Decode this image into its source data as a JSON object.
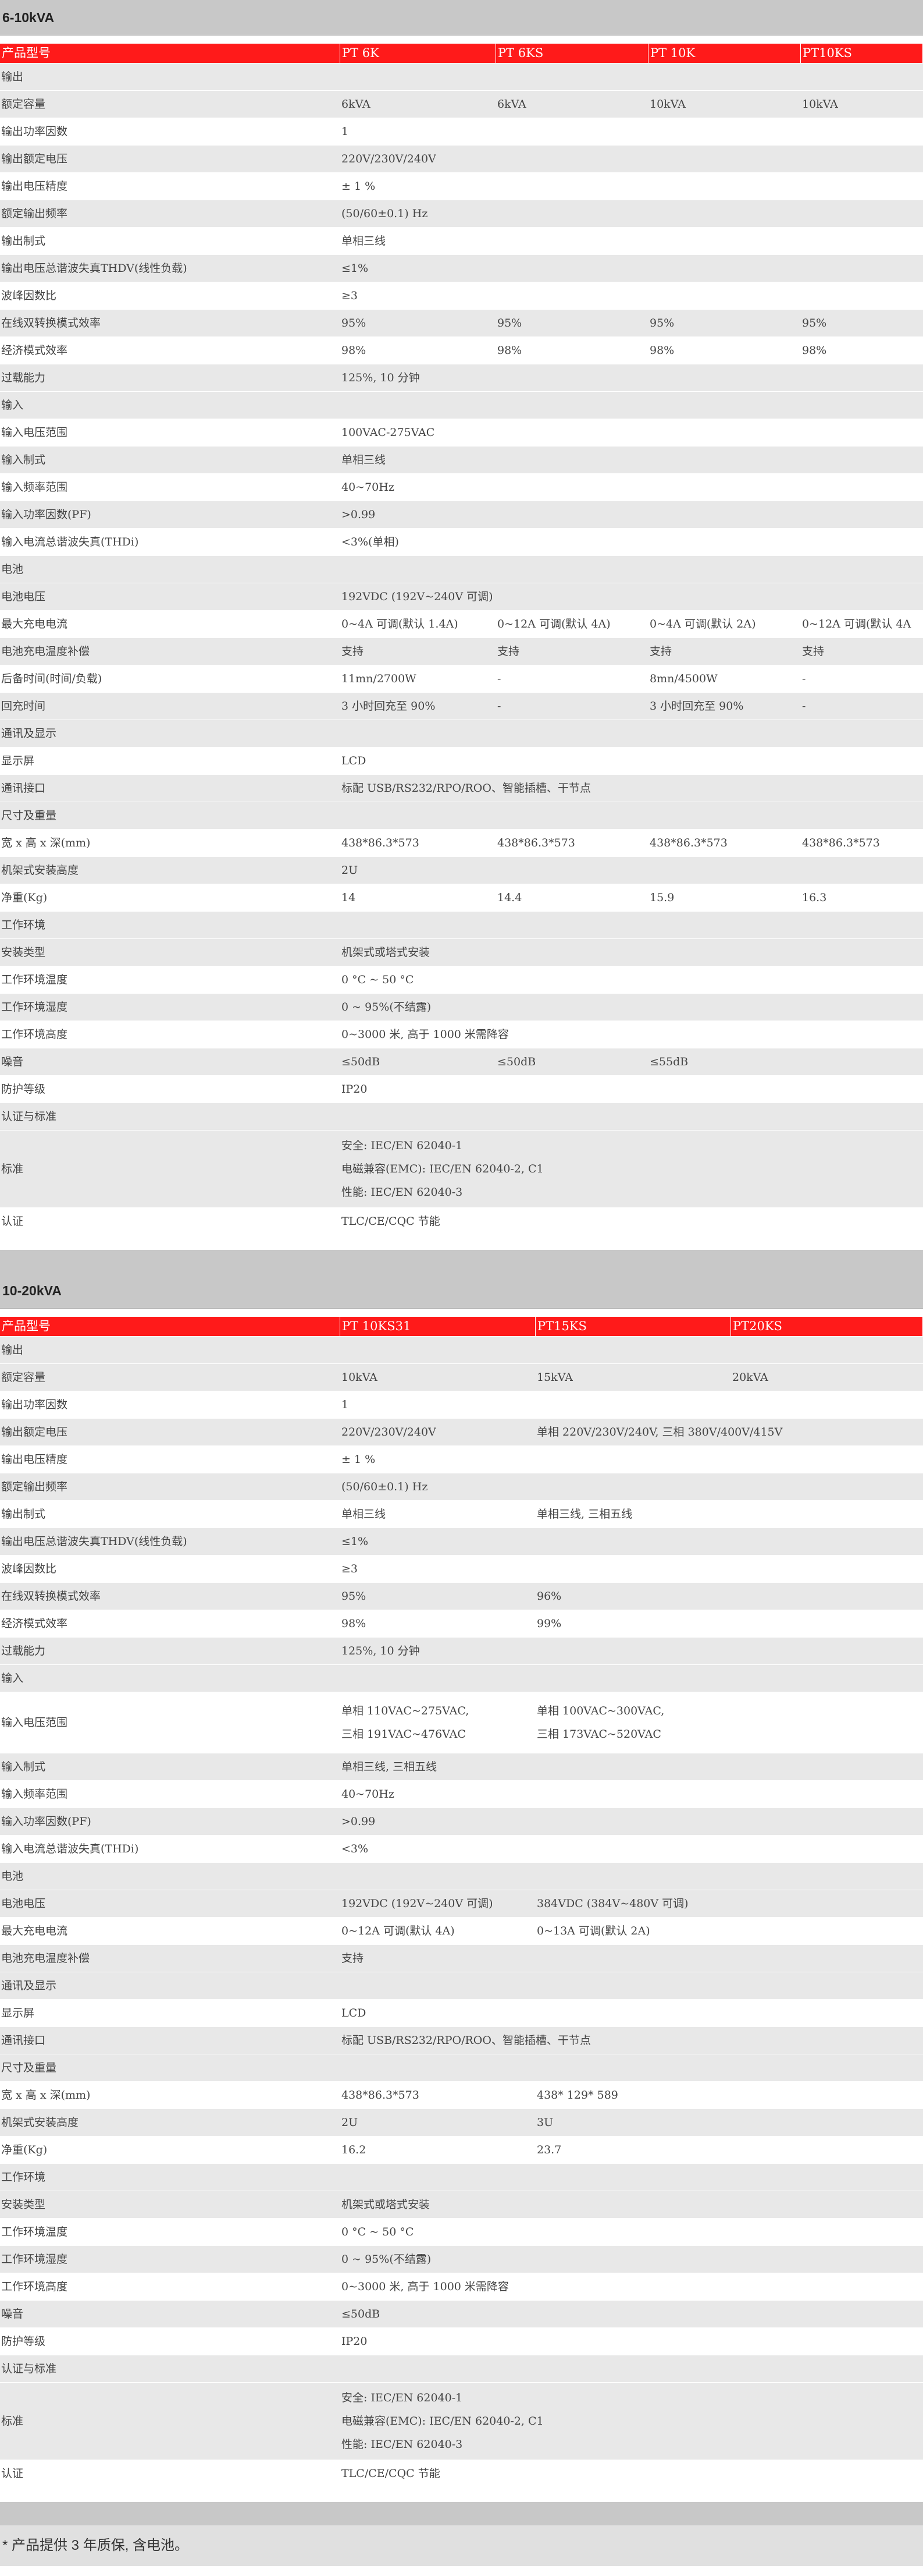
{
  "section1": {
    "title": "6-10kVA",
    "headers": [
      "产品型号",
      "PT 6K",
      "PT 6KS",
      "PT 10K",
      "PT10KS"
    ],
    "rows": [
      {
        "cells": [
          "输出"
        ],
        "cat": true
      },
      {
        "cells": [
          "额定容量",
          "6kVA",
          "6kVA",
          "10kVA",
          "10kVA"
        ]
      },
      {
        "cells": [
          "输出功率因数",
          "1"
        ]
      },
      {
        "cells": [
          "输出额定电压",
          "220V/230V/240V"
        ]
      },
      {
        "cells": [
          "输出电压精度",
          "± 1 %"
        ]
      },
      {
        "cells": [
          "额定输出频率",
          "(50/60±0.1) Hz"
        ]
      },
      {
        "cells": [
          "输出制式",
          "单相三线"
        ]
      },
      {
        "cells": [
          "输出电压总谐波失真THDV(线性负载)",
          "≤1%"
        ]
      },
      {
        "cells": [
          "波峰因数比",
          "≥3"
        ]
      },
      {
        "cells": [
          "在线双转换模式效率",
          "95%",
          "95%",
          "95%",
          "95%"
        ]
      },
      {
        "cells": [
          "经济模式效率",
          "98%",
          "98%",
          "98%",
          "98%"
        ]
      },
      {
        "cells": [
          "过载能力",
          "125%, 10 分钟"
        ]
      },
      {
        "cells": [
          "输入"
        ],
        "cat": true
      },
      {
        "cells": [
          "输入电压范围",
          "100VAC-275VAC"
        ]
      },
      {
        "cells": [
          "输入制式",
          "单相三线"
        ]
      },
      {
        "cells": [
          "输入频率范围",
          "40~70Hz"
        ]
      },
      {
        "cells": [
          "输入功率因数(PF)",
          ">0.99"
        ]
      },
      {
        "cells": [
          "输入电流总谐波失真(THDi)",
          "<3%(单相)"
        ]
      },
      {
        "cells": [
          "电池"
        ],
        "cat": true
      },
      {
        "cells": [
          "电池电压",
          "192VDC (192V~240V 可调)"
        ]
      },
      {
        "cells": [
          "最大充电电流",
          "0~4A 可调(默认 1.4A)",
          "0~12A 可调(默认 4A)",
          "0~4A 可调(默认 2A)",
          "0~12A 可调(默认 4A"
        ]
      },
      {
        "cells": [
          "电池充电温度补偿",
          "支持",
          "支持",
          "支持",
          "支持"
        ]
      },
      {
        "cells": [
          "后备时间(时间/负载)",
          "11mn/2700W",
          "-",
          "8mn/4500W",
          "-"
        ]
      },
      {
        "cells": [
          "回充时间",
          "3 小时回充至 90%",
          "-",
          "3 小时回充至 90%",
          "-"
        ]
      },
      {
        "cells": [
          "通讯及显示"
        ],
        "cat": true
      },
      {
        "cells": [
          "显示屏",
          "LCD"
        ]
      },
      {
        "cells": [
          "通讯接口",
          "标配 USB/RS232/RPO/ROO、智能插槽、干节点"
        ]
      },
      {
        "cells": [
          "尺寸及重量"
        ],
        "cat": true
      },
      {
        "cells": [
          "宽 x 高 x 深(mm)",
          "438*86.3*573",
          "438*86.3*573",
          "438*86.3*573",
          "438*86.3*573"
        ]
      },
      {
        "cells": [
          "机架式安装高度",
          "2U"
        ]
      },
      {
        "cells": [
          "净重(Kg)",
          "14",
          "14.4",
          "15.9",
          "16.3"
        ]
      },
      {
        "cells": [
          "工作环境"
        ],
        "cat": true
      },
      {
        "cells": [
          "安装类型",
          "机架式或塔式安装"
        ]
      },
      {
        "cells": [
          "工作环境温度",
          "0 °C ~ 50 °C"
        ]
      },
      {
        "cells": [
          "工作环境湿度",
          "0 ~ 95%(不结露)"
        ]
      },
      {
        "cells": [
          "工作环境高度",
          "0~3000 米, 高于 1000 米需降容"
        ]
      },
      {
        "cells": [
          "噪音",
          "≤50dB",
          "≤50dB",
          "≤55dB"
        ]
      },
      {
        "cells": [
          "防护等级",
          "IP20"
        ]
      },
      {
        "cells": [
          "认证与标准"
        ],
        "cat": true
      },
      {
        "cells": [
          "标准",
          "安全: IEC/EN 62040-1\n电磁兼容(EMC): IEC/EN 62040-2, C1\n性能: IEC/EN 62040-3"
        ],
        "multi": true
      },
      {
        "cells": [
          "认证",
          "TLC/CE/CQC 节能"
        ]
      }
    ]
  },
  "section2": {
    "title": "10-20kVA",
    "headers": [
      "产品型号",
      "PT 10KS31",
      "PT15KS",
      "PT20KS"
    ],
    "rows": [
      {
        "cells": [
          "输出"
        ],
        "cat": true
      },
      {
        "cells": [
          "额定容量",
          "10kVA",
          "15kVA",
          "20kVA"
        ]
      },
      {
        "cells": [
          "输出功率因数",
          "1"
        ]
      },
      {
        "cells": [
          "输出额定电压",
          "220V/230V/240V",
          "单相 220V/230V/240V, 三相 380V/400V/415V"
        ]
      },
      {
        "cells": [
          "输出电压精度",
          "± 1 %"
        ]
      },
      {
        "cells": [
          "额定输出频率",
          "(50/60±0.1) Hz"
        ]
      },
      {
        "cells": [
          "输出制式",
          "单相三线",
          "单相三线, 三相五线"
        ]
      },
      {
        "cells": [
          "输出电压总谐波失真THDV(线性负载)",
          "≤1%"
        ]
      },
      {
        "cells": [
          "波峰因数比",
          "≥3"
        ]
      },
      {
        "cells": [
          "在线双转换模式效率",
          "95%",
          "96%"
        ]
      },
      {
        "cells": [
          "经济模式效率",
          "98%",
          "99%"
        ]
      },
      {
        "cells": [
          "过载能力",
          "125%, 10 分钟"
        ]
      },
      {
        "cells": [
          "输入"
        ],
        "cat": true
      },
      {
        "cells": [
          "输入电压范围",
          "单相 110VAC~275VAC,\n三相 191VAC~476VAC",
          "单相 100VAC~300VAC,\n三相 173VAC~520VAC"
        ],
        "multi": true
      },
      {
        "cells": [
          "输入制式",
          "单相三线, 三相五线"
        ]
      },
      {
        "cells": [
          "输入频率范围",
          "40~70Hz"
        ]
      },
      {
        "cells": [
          "输入功率因数(PF)",
          ">0.99"
        ]
      },
      {
        "cells": [
          "输入电流总谐波失真(THDi)",
          "<3%"
        ]
      },
      {
        "cells": [
          "电池"
        ],
        "cat": true
      },
      {
        "cells": [
          "电池电压",
          "192VDC (192V~240V 可调)",
          "384VDC (384V~480V 可调)"
        ]
      },
      {
        "cells": [
          "最大充电电流",
          "0~12A 可调(默认 4A)",
          "0~13A 可调(默认 2A)"
        ]
      },
      {
        "cells": [
          "电池充电温度补偿",
          "支持"
        ]
      },
      {
        "cells": [
          "通讯及显示"
        ],
        "cat": true
      },
      {
        "cells": [
          "显示屏",
          "LCD"
        ]
      },
      {
        "cells": [
          "通讯接口",
          "标配 USB/RS232/RPO/ROO、智能插槽、干节点"
        ]
      },
      {
        "cells": [
          "尺寸及重量"
        ],
        "cat": true
      },
      {
        "cells": [
          "宽 x 高 x 深(mm)",
          "438*86.3*573",
          "438* 129* 589"
        ]
      },
      {
        "cells": [
          "机架式安装高度",
          "2U",
          "3U"
        ]
      },
      {
        "cells": [
          "净重(Kg)",
          "16.2",
          "23.7"
        ]
      },
      {
        "cells": [
          "工作环境"
        ],
        "cat": true
      },
      {
        "cells": [
          "安装类型",
          "机架式或塔式安装"
        ]
      },
      {
        "cells": [
          "工作环境温度",
          "0 °C ~ 50 °C"
        ]
      },
      {
        "cells": [
          "工作环境湿度",
          "0 ~ 95%(不结露)"
        ]
      },
      {
        "cells": [
          "工作环境高度",
          "0~3000 米, 高于 1000 米需降容"
        ]
      },
      {
        "cells": [
          "噪音",
          "≤50dB"
        ]
      },
      {
        "cells": [
          "防护等级",
          "IP20"
        ]
      },
      {
        "cells": [
          "认证与标准"
        ],
        "cat": true
      },
      {
        "cells": [
          "标准",
          "安全: IEC/EN 62040-1\n电磁兼容(EMC): IEC/EN 62040-2, C1\n性能: IEC/EN 62040-3"
        ],
        "multi": true
      },
      {
        "cells": [
          "认证",
          "TLC/CE/CQC 节能"
        ]
      }
    ]
  },
  "footnote": "* 产品提供 3 年质保, 含电池。"
}
